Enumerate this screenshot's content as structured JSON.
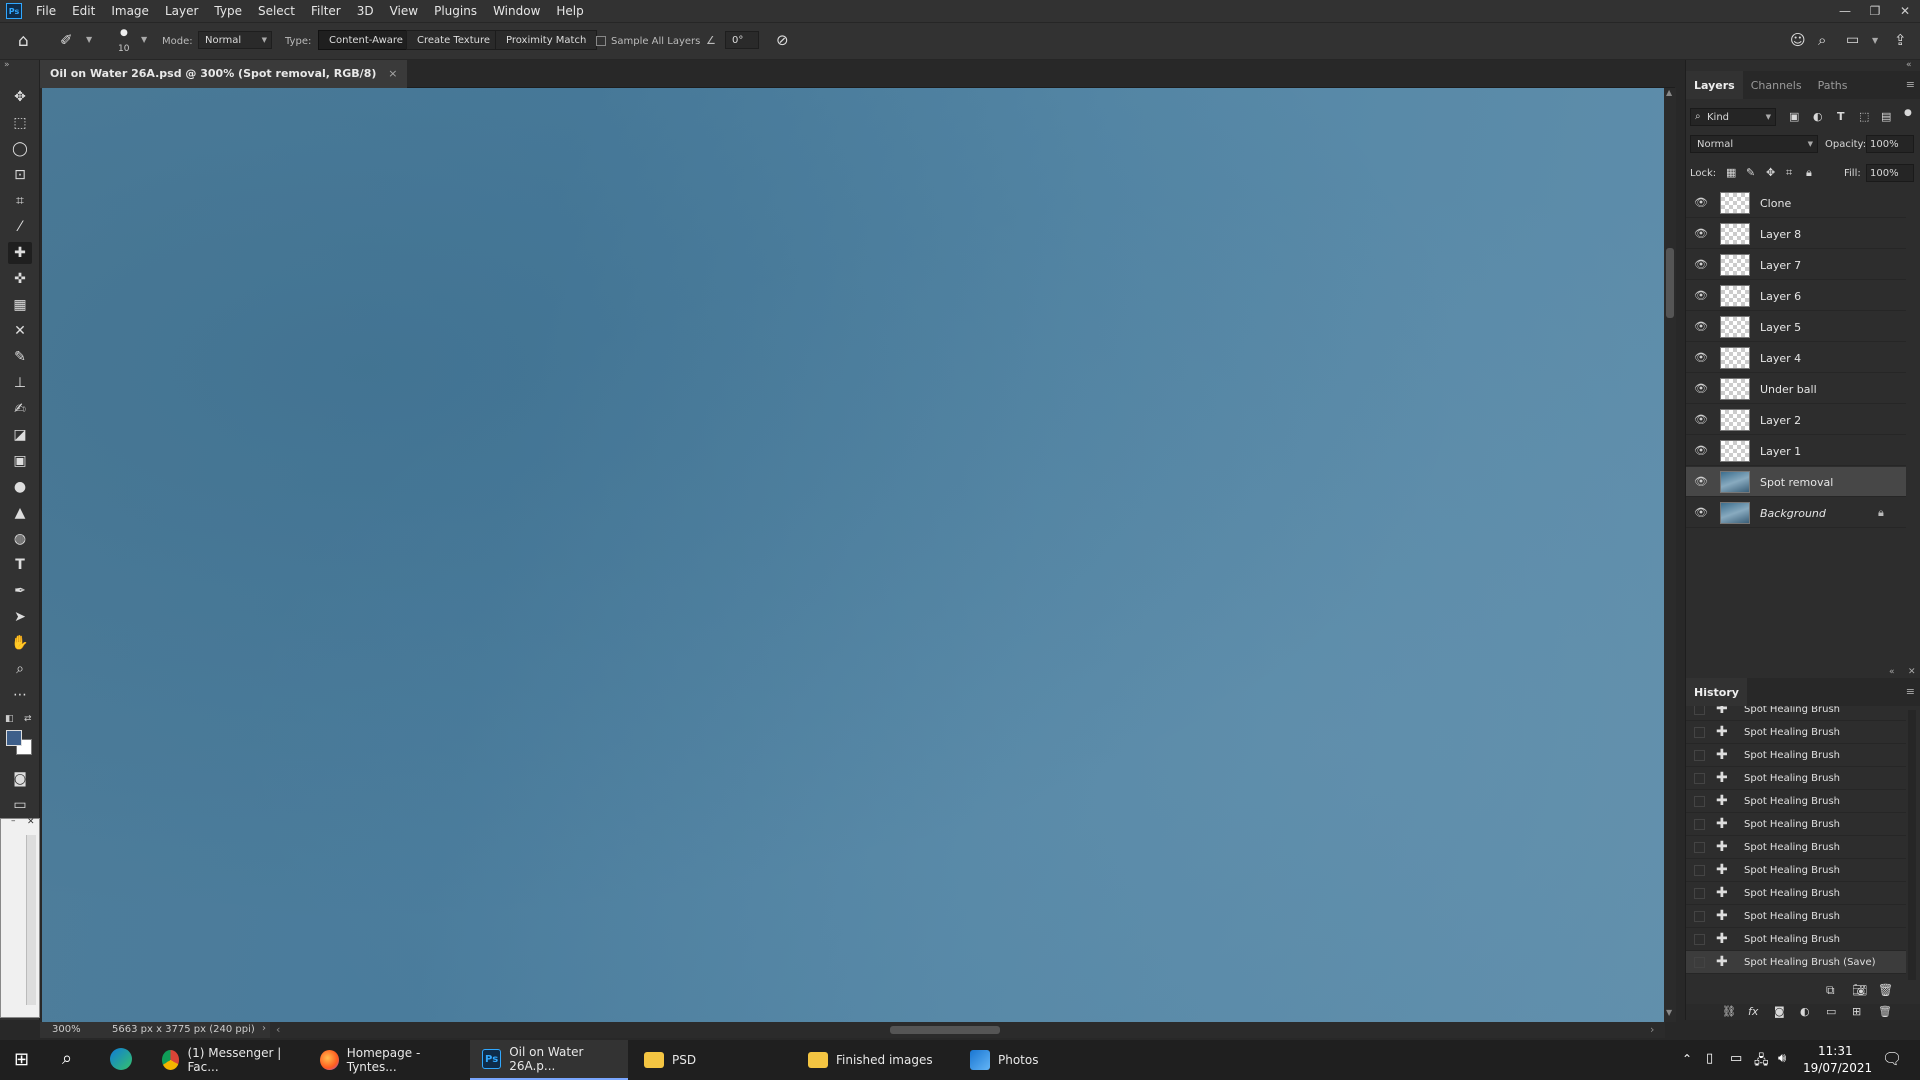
{
  "menubar": {
    "logo": "Ps",
    "items": [
      "File",
      "Edit",
      "Image",
      "Layer",
      "Type",
      "Select",
      "Filter",
      "3D",
      "View",
      "Plugins",
      "Window",
      "Help"
    ]
  },
  "options": {
    "brush_size": "10",
    "mode_label": "Mode:",
    "mode_value": "Normal",
    "type_label": "Type:",
    "type_buttons": [
      "Content-Aware",
      "Create Texture",
      "Proximity Match"
    ],
    "sample_all_layers": "Sample All Layers",
    "angle_value": "0°"
  },
  "document": {
    "tab_title": "Oil on Water 26A.psd @ 300% (Spot removal, RGB/8)",
    "zoom": "300%",
    "info": "5663 px x 3775 px (240 ppi)"
  },
  "layers_panel": {
    "tabs": [
      "Layers",
      "Channels",
      "Paths"
    ],
    "filter_kind": "Kind",
    "blend_mode": "Normal",
    "opacity_label": "Opacity:",
    "opacity_value": "100%",
    "lock_label": "Lock:",
    "fill_label": "Fill:",
    "fill_value": "100%",
    "layers": [
      {
        "name": "Clone"
      },
      {
        "name": "Layer 8"
      },
      {
        "name": "Layer 7"
      },
      {
        "name": "Layer 6"
      },
      {
        "name": "Layer 5"
      },
      {
        "name": "Layer 4"
      },
      {
        "name": "Under ball"
      },
      {
        "name": "Layer 2"
      },
      {
        "name": "Layer 1"
      },
      {
        "name": "Spot removal"
      },
      {
        "name": "Background"
      }
    ]
  },
  "history_panel": {
    "title": "History",
    "items": [
      "Spot Healing Brush",
      "Spot Healing Brush",
      "Spot Healing Brush",
      "Spot Healing Brush",
      "Spot Healing Brush",
      "Spot Healing Brush",
      "Spot Healing Brush",
      "Spot Healing Brush",
      "Spot Healing Brush",
      "Spot Healing Brush",
      "Spot Healing Brush",
      "Spot Healing Brush (Save)"
    ]
  },
  "taskbar": {
    "apps": [
      {
        "label": "(1) Messenger | Fac...",
        "icon": "chrome-icon"
      },
      {
        "label": "Homepage - Tyntes...",
        "icon": "firefox-icon"
      },
      {
        "label": "Oil on Water 26A.p...",
        "icon": "photoshop-icon"
      },
      {
        "label": "PSD",
        "icon": "folder-icon"
      },
      {
        "label": "Finished images",
        "icon": "folder-icon"
      },
      {
        "label": "Photos",
        "icon": "photos-icon"
      }
    ],
    "time": "11:31",
    "date": "19/07/2021"
  },
  "colors": {
    "canvas": "#4f809f",
    "accent": "#31a8ff",
    "foreground_swatch": "#3e5f8a",
    "background_swatch": "#ffffff"
  }
}
